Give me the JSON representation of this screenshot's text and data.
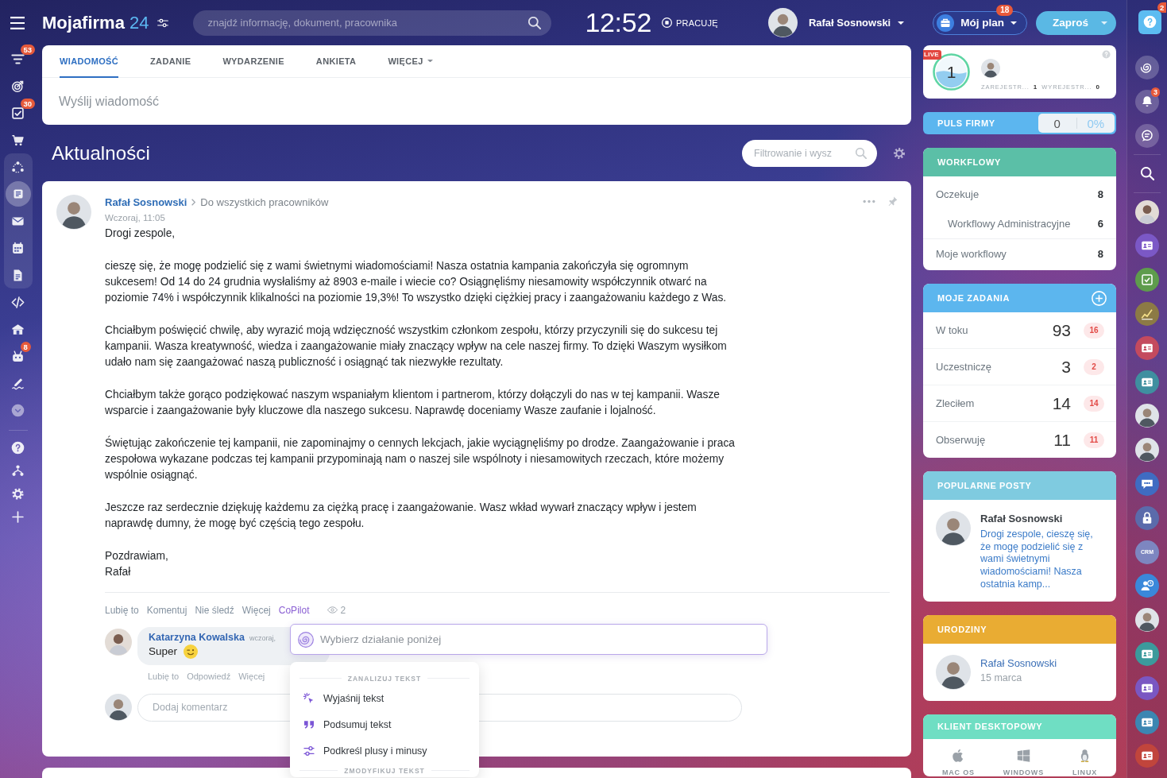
{
  "topbar": {
    "logo": "Mojafirma",
    "logo_suffix": "24",
    "search": {
      "placeholder": "znajdź informację, dokument, pracownika"
    },
    "clock": "12:52",
    "status": "PRACUJĘ",
    "user": {
      "name": "Rafał Sosnowski"
    },
    "plan_button": {
      "label": "Mój plan",
      "badge": "18"
    },
    "invite_button": {
      "label": "Zaproś"
    }
  },
  "sidebar": {
    "sections": [
      {
        "highlighted": false,
        "items": [
          {
            "selected": false,
            "badge": "53"
          },
          {
            "selected": false
          },
          {
            "selected": false,
            "badge": "30"
          },
          {
            "selected": false
          }
        ]
      },
      {
        "highlighted": true,
        "items": [
          {
            "selected": false
          },
          {
            "selected": true
          },
          {
            "selected": false
          },
          {
            "selected": false
          },
          {
            "selected": false
          }
        ]
      },
      {
        "highlighted": false,
        "items": [
          {
            "selected": false
          },
          {
            "selected": false
          },
          {
            "selected": false,
            "badge": "8"
          },
          {
            "selected": false
          },
          {
            "selected": false
          }
        ]
      },
      {
        "highlighted": false,
        "items": [
          {
            "selected": false
          },
          {
            "selected": false
          },
          {
            "selected": false
          },
          {
            "selected": false
          }
        ]
      }
    ]
  },
  "composer": {
    "tabs": [
      {
        "label": "WIADOMOŚĆ",
        "selected": true,
        "menu": false
      },
      {
        "label": "ZADANIE",
        "selected": false,
        "menu": false
      },
      {
        "label": "WYDARZENIE",
        "selected": false,
        "menu": false
      },
      {
        "label": "ANKIETA",
        "selected": false,
        "menu": false
      },
      {
        "label": "WIĘCEJ",
        "selected": false,
        "menu": true
      }
    ],
    "placeholder": "Wyślij wiadomość"
  },
  "feed": {
    "title": "Aktualności",
    "filter": {
      "placeholder": "Filtrowanie i wysz"
    },
    "post": {
      "author": "Rafał Sosnowski",
      "audience": "Do wszystkich pracowników",
      "time": "Wczoraj, 11:05",
      "paragraphs": [
        [
          "Drogi zespole,"
        ],
        [
          "cieszę się, że mogę podzielić się z wami świetnymi wiadomościami! Nasza ostatnia kampania zakończyła się ogromnym",
          "sukcesem! Od 14 do 24 grudnia wysłaliśmy aż 8903 e-maile i wiecie co? Osiągnęliśmy niesamowity współczynnik otwarć na",
          "poziomie 74% i współczynnik klikalności na poziomie 19,3%! To wszystko dzięki ciężkiej pracy i zaangażowaniu każdego z Was."
        ],
        [
          "Chciałbym poświęcić chwilę, aby wyrazić moją wdzięczność wszystkim członkom zespołu, którzy przyczynili się do sukcesu tej",
          "kampanii. Wasza kreatywność, wiedza i zaangażowanie miały znaczący wpływ na cele naszej firmy. To dzięki Waszym wysiłkom",
          "udało nam się zaangażować naszą publiczność i osiągnąć tak niezwykłe rezultaty."
        ],
        [
          "Chciałbym także gorąco podziękować naszym wspaniałym klientom i partnerom, którzy dołączyli do nas w tej kampanii. Wasze",
          "wsparcie i zaangażowanie były kluczowe dla naszego sukcesu. Naprawdę doceniamy Wasze zaufanie i lojalność."
        ],
        [
          "Świętując zakończenie tej kampanii, nie zapominajmy o cennych lekcjach, jakie wyciągnęliśmy po drodze. Zaangażowanie i praca",
          "zespołowa wykazane podczas tej kampanii przypominają nam o naszej sile wspólnoty i niesamowitych rzeczach, które możemy",
          "wspólnie osiągnąć."
        ],
        [
          "Jeszcze raz serdecznie dziękuję każdemu za ciężką pracę i zaangażowanie. Wasz wkład wywarł znaczący wpływ i jestem",
          "naprawdę dumny, że mogę być częścią tego zespołu."
        ],
        [
          "Pozdrawiam,",
          "Rafał"
        ]
      ],
      "actions": [
        {
          "label": "Lubię to",
          "selected": false
        },
        {
          "label": "Komentuj",
          "selected": false
        },
        {
          "label": "Nie śledź",
          "selected": false
        },
        {
          "label": "Więcej",
          "selected": false
        },
        {
          "label": "CoPilot",
          "selected": true
        }
      ],
      "views": "2",
      "comments": [
        {
          "author": "Katarzyna Kowalska",
          "time": "wczoraj,",
          "text": "Super",
          "actions": [
            "Lubię to",
            "Odpowiedź",
            "Więcej"
          ]
        }
      ],
      "comment_field": {
        "placeholder": "Dodaj komentarz"
      },
      "copilot": {
        "placeholder": "Wybierz działanie poniżej",
        "menu": [
          {
            "kind": "header",
            "label": "ZANALIZUJ TEKST"
          },
          {
            "kind": "item",
            "label": "Wyjaśnij tekst"
          },
          {
            "kind": "item",
            "label": "Podsumuj tekst"
          },
          {
            "kind": "item",
            "label": "Podkreśl plusy i minusy"
          },
          {
            "kind": "header",
            "label": "ZMODYFIKUJ TEKST"
          }
        ]
      }
    }
  },
  "widgets": {
    "live": {
      "badge": "LIVE",
      "count": "1",
      "stats": [
        {
          "label": "ZAREJESTR...",
          "value": "1"
        },
        {
          "label": "WYREJESTR...",
          "value": "0"
        }
      ]
    },
    "pulse": {
      "title": "PULS FIRMY",
      "value": "0",
      "percent": "0%"
    },
    "workflows": {
      "title": "WORKFLOWY",
      "rows": [
        {
          "label": "Oczekuje",
          "count": "8",
          "children": [
            {
              "label": "Workflowy Administracyjne",
              "count": "6"
            }
          ]
        },
        {
          "label": "Moje workflowy",
          "count": "8"
        }
      ]
    },
    "tasks": {
      "title": "MOJE ZADANIA",
      "rows": [
        {
          "label": "W toku",
          "count": "93",
          "badge": "16"
        },
        {
          "label": "Uczestniczę",
          "count": "3",
          "badge": "2"
        },
        {
          "label": "Zleciłem",
          "count": "14",
          "badge": "14"
        },
        {
          "label": "Obserwuję",
          "count": "11",
          "badge": "11"
        }
      ]
    },
    "popular": {
      "title": "POPULARNE POSTY",
      "posts": [
        {
          "author": "Rafał Sosnowski",
          "excerpt": "Drogi zespole, cieszę się, że mogę podzielić się z wami świetnymi wiadomościami! Nasza ostatnia kamp..."
        }
      ]
    },
    "birthdays": {
      "title": "URODZINY",
      "people": [
        {
          "name": "Rafał Sosnowski",
          "date": "15 marca"
        }
      ]
    },
    "desktop_client": {
      "title": "KLIENT DESKTOPOWY",
      "platforms": [
        {
          "label": "MAC OS"
        },
        {
          "label": "WINDOWS"
        },
        {
          "label": "LINUX"
        }
      ]
    }
  },
  "rightbar": {
    "help_badge": "2",
    "items": [
      {
        "kind": "tool"
      },
      {
        "kind": "tool",
        "badge": "3"
      },
      {
        "kind": "tool"
      },
      {
        "kind": "search"
      },
      {
        "kind": "avatar"
      },
      {
        "kind": "app"
      },
      {
        "kind": "app"
      },
      {
        "kind": "app"
      },
      {
        "kind": "app"
      },
      {
        "kind": "app"
      },
      {
        "kind": "avatar"
      },
      {
        "kind": "avatar"
      },
      {
        "kind": "app"
      },
      {
        "kind": "app"
      },
      {
        "kind": "app",
        "label": "CRM"
      },
      {
        "kind": "app"
      },
      {
        "kind": "avatar"
      },
      {
        "kind": "app"
      },
      {
        "kind": "app"
      },
      {
        "kind": "app"
      },
      {
        "kind": "app"
      }
    ]
  }
}
